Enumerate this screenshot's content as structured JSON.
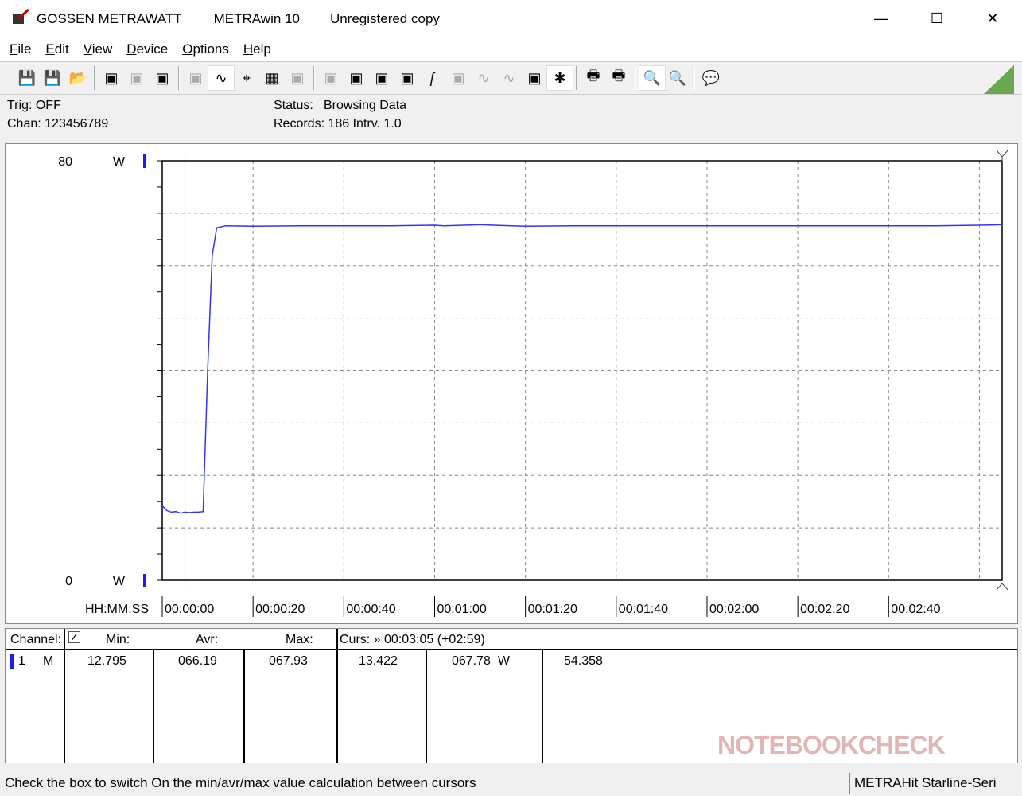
{
  "window": {
    "brand": "GOSSEN METRAWATT",
    "app": "METRAwin 10",
    "license": "Unregistered copy"
  },
  "menu": [
    "File",
    "Edit",
    "View",
    "Device",
    "Options",
    "Help"
  ],
  "toolbar_icons": [
    "save-icon",
    "save-as-icon",
    "open-icon",
    "device-read-icon",
    "device-transfer-icon",
    "device-write-icon",
    "print-list-icon",
    "graph-icon",
    "cursor-icon",
    "table-icon",
    "bar-icon",
    "config-icon",
    "config2-icon",
    "scan-icon",
    "monitor-icon",
    "function-icon",
    "memory-icon",
    "wave-icon",
    "wave2-icon",
    "dump-icon",
    "bug-icon",
    "print-icon",
    "print2-icon",
    "zoom-icon",
    "zoom-out-icon",
    "message-icon"
  ],
  "info": {
    "trig": "Trig: OFF",
    "chan": "Chan:  123456789",
    "status_label": "Status:",
    "status_value": "Browsing Data",
    "records": "Records: 186  Intrv. 1.0"
  },
  "chart_data": {
    "type": "line",
    "ylabel_unit": "W",
    "ylim": [
      0,
      80
    ],
    "ytick_labels": [
      "80",
      "0"
    ],
    "xlabel": "HH:MM:SS",
    "xlim": [
      0,
      185
    ],
    "xtick_labels": [
      "00:00:00",
      "00:00:20",
      "00:00:40",
      "00:01:00",
      "00:01:20",
      "00:01:40",
      "00:02:00",
      "00:02:20",
      "00:02:40"
    ],
    "grid": true,
    "cursor_time_s": 5,
    "series_color": "#3333ff",
    "series": [
      {
        "x": [
          0,
          1,
          2,
          3,
          4,
          5,
          6,
          7,
          8,
          9,
          10,
          11,
          12,
          13,
          14,
          20,
          30,
          40,
          50,
          60,
          62,
          70,
          80,
          90,
          100,
          110,
          120,
          130,
          140,
          150,
          160,
          170,
          180,
          185
        ],
        "y": [
          14.2,
          13.3,
          13.0,
          13.1,
          12.8,
          13.0,
          12.9,
          13.0,
          13.0,
          13.1,
          40,
          62,
          67.2,
          67.4,
          67.6,
          67.5,
          67.6,
          67.6,
          67.6,
          67.7,
          67.6,
          67.8,
          67.5,
          67.6,
          67.6,
          67.6,
          67.6,
          67.6,
          67.6,
          67.6,
          67.6,
          67.6,
          67.7,
          67.8
        ]
      }
    ]
  },
  "table": {
    "headers": {
      "channel": "Channel:",
      "min": "Min:",
      "avr": "Avr:",
      "max": "Max:",
      "curs": "Curs: » 00:03:05 (+02:59)"
    },
    "row": {
      "ch": "1",
      "mode": "M",
      "min": "12.795",
      "avr": "066.19",
      "max": "067.93",
      "c1": "13.422",
      "c2": "067.78  W",
      "c3": "54.358"
    }
  },
  "statusbar": {
    "hint": "Check the box to switch On the min/avr/max value calculation between cursors",
    "device": "METRAHit Starline-Seri"
  },
  "watermark": "NOTEBOOKCHECK"
}
